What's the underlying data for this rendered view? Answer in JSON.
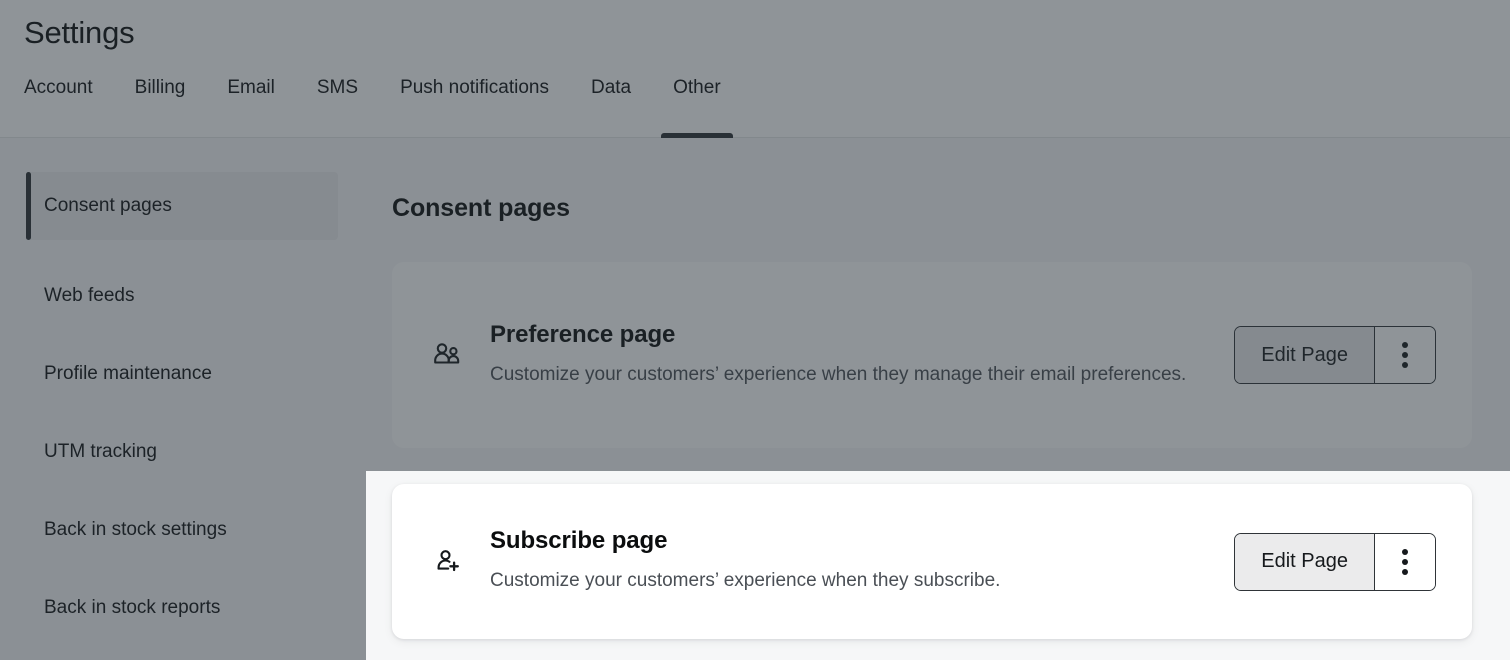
{
  "header": {
    "title": "Settings",
    "tabs": [
      {
        "label": "Account",
        "active": false
      },
      {
        "label": "Billing",
        "active": false
      },
      {
        "label": "Email",
        "active": false
      },
      {
        "label": "SMS",
        "active": false
      },
      {
        "label": "Push notifications",
        "active": false
      },
      {
        "label": "Data",
        "active": false
      },
      {
        "label": "Other",
        "active": true
      }
    ]
  },
  "sidebar": {
    "items": [
      {
        "label": "Consent pages",
        "active": true
      },
      {
        "label": "Web feeds",
        "active": false
      },
      {
        "label": "Profile maintenance",
        "active": false
      },
      {
        "label": "UTM tracking",
        "active": false
      },
      {
        "label": "Back in stock settings",
        "active": false
      },
      {
        "label": "Back in stock reports",
        "active": false
      }
    ]
  },
  "main": {
    "section_title": "Consent pages",
    "cards": [
      {
        "id": "preference",
        "icon": "users-icon",
        "title": "Preference page",
        "description": "Customize your customers’ experience when they manage their email preferences.",
        "primary_label": "Edit Page",
        "menu_icon": "vertical-dots-icon"
      },
      {
        "id": "subscribe",
        "icon": "user-plus-icon",
        "title": "Subscribe page",
        "description": "Customize your customers’ experience when they subscribe.",
        "primary_label": "Edit Page",
        "menu_icon": "vertical-dots-icon"
      }
    ]
  },
  "colors": {
    "accent": "#2b2f33",
    "page_background": "#f6f7f8",
    "card_background": "#ffffff",
    "button_fill": "#ebebec",
    "dim_overlay": "rgba(40,49,58,0.52)"
  }
}
